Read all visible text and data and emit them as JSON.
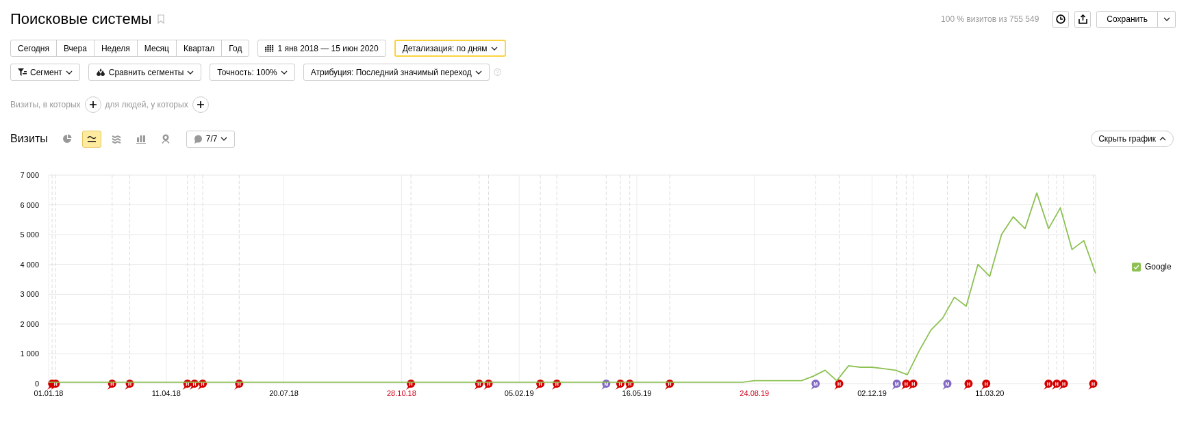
{
  "title": "Поисковые системы",
  "summary": "100 % визитов из 755 549",
  "save_button": "Сохранить",
  "periods": [
    {
      "label": "Сегодня",
      "selected": false
    },
    {
      "label": "Вчера",
      "selected": false
    },
    {
      "label": "Неделя",
      "selected": false
    },
    {
      "label": "Месяц",
      "selected": false
    },
    {
      "label": "Квартал",
      "selected": false
    },
    {
      "label": "Год",
      "selected": false
    }
  ],
  "date_range": "1 янв 2018 — 15 июн 2020",
  "detail": "Детализация: по дням",
  "filters": [
    {
      "kind": "segment",
      "label": "Сегмент"
    },
    {
      "kind": "compare",
      "label": "Сравнить сегменты"
    },
    {
      "kind": "plain",
      "label": "Точность: 100%"
    },
    {
      "kind": "plain",
      "label": "Атрибуция: Последний значимый переход"
    }
  ],
  "segment_conditions": [
    "Визиты, в которых",
    "для людей, у которых"
  ],
  "chart_header": {
    "title": "Визиты",
    "views": [
      {
        "kind": "pie",
        "selected": false
      },
      {
        "kind": "line",
        "selected": true
      },
      {
        "kind": "area",
        "selected": false
      },
      {
        "kind": "bar",
        "selected": false
      },
      {
        "kind": "map",
        "selected": false
      }
    ],
    "notes": "7/7",
    "hide_button": "Скрыть график"
  },
  "legend": [
    {
      "checked": true
    }
  ],
  "x_tick_holidays": [
    false,
    false,
    false,
    true,
    false,
    false,
    true,
    false,
    false
  ],
  "chart_notes": [
    {
      "color": "#d40000"
    },
    {
      "text": "Н",
      "color": "#d40000"
    },
    {
      "text": "Н",
      "color": "#d40000"
    },
    {
      "text": "Н",
      "color": "#d40000"
    },
    {
      "text": "Н",
      "color": "#d40000"
    },
    {
      "text": "Н",
      "color": "#d40000"
    },
    {
      "text": "Н",
      "color": "#d40000"
    },
    {
      "text": "Н",
      "color": "#d40000"
    },
    {
      "text": "Н",
      "color": "#d40000"
    },
    {
      "text": "Н",
      "color": "#d40000"
    },
    {
      "text": "Н",
      "color": "#d40000"
    },
    {
      "text": "Н",
      "color": "#d40000"
    },
    {
      "text": "Н",
      "color": "#d40000"
    },
    {
      "text": "М",
      "color": "#8068c4"
    },
    {
      "text": "Н",
      "color": "#d40000"
    },
    {
      "text": "Н",
      "color": "#d40000"
    },
    {
      "text": "Н",
      "color": "#d40000"
    },
    {
      "text": "М",
      "color": "#8068c4"
    },
    {
      "text": "Н",
      "color": "#d40000"
    },
    {
      "text": "М",
      "color": "#8068c4"
    },
    {
      "text": "Н",
      "color": "#d40000"
    },
    {
      "text": "Н",
      "color": "#d40000"
    },
    {
      "text": "М",
      "color": "#8068c4"
    },
    {
      "text": "Н",
      "color": "#d40000"
    },
    {
      "text": "Н",
      "color": "#d40000"
    },
    {
      "text": "Н",
      "color": "#d40000"
    },
    {
      "text": "Н",
      "color": "#d40000"
    },
    {
      "text": "Н",
      "color": "#d40000"
    },
    {
      "text": "Н",
      "color": "#d40000"
    }
  ],
  "chart_data": {
    "type": "line",
    "grid": true,
    "ylim": [
      0,
      7000
    ],
    "yticks": [
      0,
      1000,
      2000,
      3000,
      4000,
      5000,
      6000,
      7000
    ],
    "categories": [
      "01.01.18",
      null,
      null,
      null,
      null,
      null,
      null,
      null,
      null,
      null,
      "11.04.18",
      null,
      null,
      null,
      null,
      null,
      null,
      null,
      null,
      null,
      "20.07.18",
      null,
      null,
      null,
      null,
      null,
      null,
      null,
      null,
      null,
      "28.10.18",
      null,
      null,
      null,
      null,
      null,
      null,
      null,
      null,
      null,
      "05.02.19",
      null,
      null,
      null,
      null,
      null,
      null,
      null,
      null,
      null,
      "16.05.19",
      null,
      null,
      null,
      null,
      null,
      null,
      null,
      null,
      null,
      "24.08.19",
      null,
      null,
      null,
      null,
      null,
      null,
      null,
      null,
      null,
      "02.12.19",
      null,
      null,
      null,
      null,
      null,
      null,
      null,
      null,
      null,
      "11.03.20",
      null,
      null,
      null,
      null,
      null,
      null,
      null,
      null,
      null
    ],
    "series": [
      {
        "name": "Google",
        "color": "#8cc152",
        "values": [
          50,
          50,
          50,
          50,
          50,
          50,
          50,
          50,
          50,
          50,
          50,
          50,
          50,
          50,
          50,
          50,
          50,
          50,
          50,
          50,
          50,
          50,
          50,
          50,
          50,
          50,
          50,
          50,
          50,
          50,
          50,
          50,
          50,
          50,
          50,
          50,
          50,
          50,
          50,
          50,
          50,
          50,
          50,
          50,
          50,
          50,
          50,
          50,
          50,
          50,
          50,
          50,
          50,
          50,
          50,
          50,
          50,
          50,
          50,
          50,
          100,
          100,
          100,
          100,
          100,
          250,
          450,
          100,
          600,
          550,
          550,
          500,
          450,
          300,
          1100,
          1800,
          2200,
          2900,
          2600,
          4000,
          3600,
          5000,
          5600,
          5200,
          6400,
          5200,
          5900,
          4500,
          4800,
          3700
        ]
      }
    ]
  }
}
